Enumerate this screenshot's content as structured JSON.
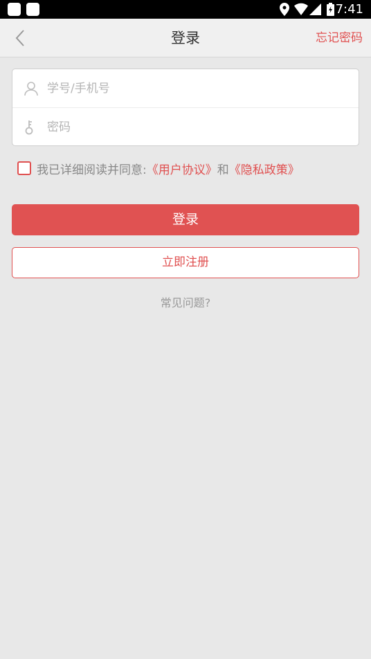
{
  "status_bar": {
    "time": "7:41",
    "icons": [
      "app-icon",
      "app-icon",
      "location-icon",
      "wifi-icon",
      "signal-icon",
      "battery-icon"
    ]
  },
  "header": {
    "title": "登录",
    "forgot_label": "忘记密码",
    "back_icon": "chevron-left-icon"
  },
  "form": {
    "username_placeholder": "学号/手机号",
    "username_value": "",
    "username_icon": "user-icon",
    "password_placeholder": "密码",
    "password_value": "",
    "password_icon": "key-icon"
  },
  "agreement": {
    "checked": false,
    "prefix": "我已详细阅读并同意:",
    "user_agreement": "《用户协议》",
    "conjunction": "和",
    "privacy_policy": "《隐私政策》"
  },
  "actions": {
    "login_label": "登录",
    "register_label": "立即注册",
    "faq_label": "常见问题?"
  },
  "colors": {
    "accent": "#e05050",
    "background": "#e8e8e8",
    "header_background": "#f0f0f0"
  }
}
